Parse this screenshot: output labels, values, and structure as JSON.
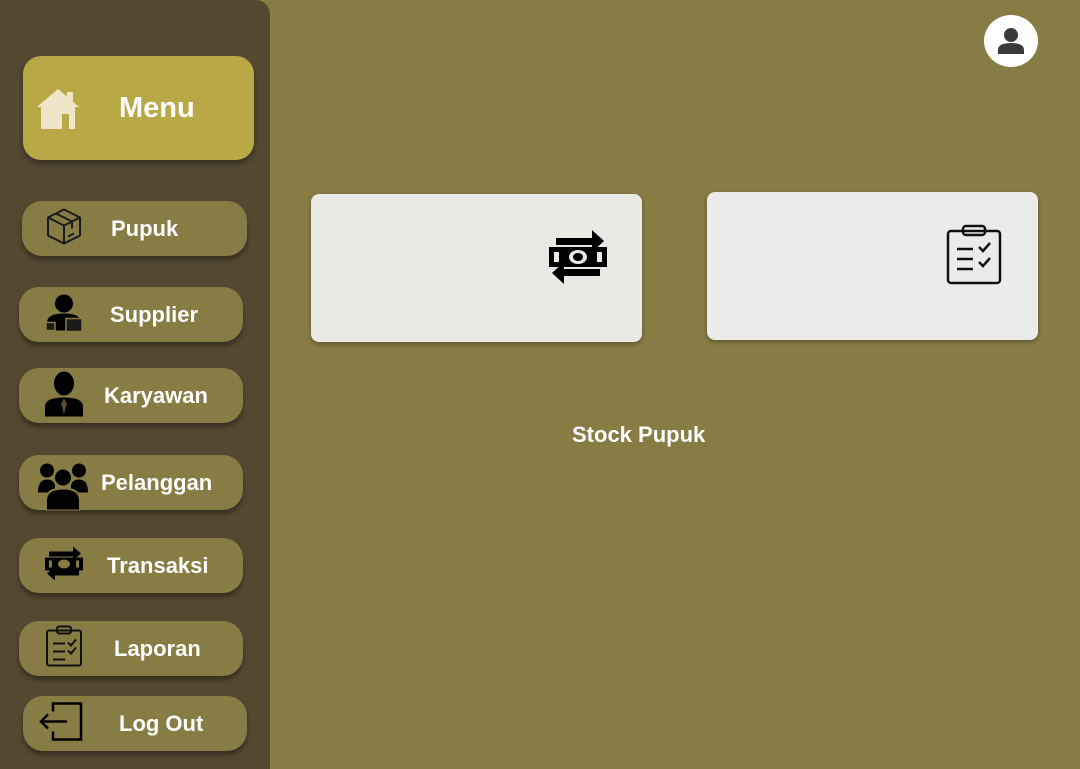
{
  "sidebar": {
    "menu_label": "Menu",
    "items": [
      {
        "label": "Pupuk",
        "icon": "package-box-icon"
      },
      {
        "label": "Supplier",
        "icon": "supplier-person-icon"
      },
      {
        "label": "Karyawan",
        "icon": "employee-icon"
      },
      {
        "label": "Pelanggan",
        "icon": "customers-group-icon"
      },
      {
        "label": "Transaksi",
        "icon": "money-exchange-icon"
      },
      {
        "label": "Laporan",
        "icon": "clipboard-checklist-icon"
      },
      {
        "label": "Log Out",
        "icon": "logout-icon"
      }
    ]
  },
  "header": {
    "avatar_icon": "user-icon"
  },
  "main": {
    "cards": [
      {
        "icon": "money-exchange-icon"
      },
      {
        "icon": "clipboard-checklist-icon"
      }
    ],
    "caption": "Stock Pupuk"
  },
  "colors": {
    "background": "#877c44",
    "sidebar": "#544831",
    "accent": "#b9a846",
    "card": "#e8e8e5",
    "text": "#ffffff"
  }
}
